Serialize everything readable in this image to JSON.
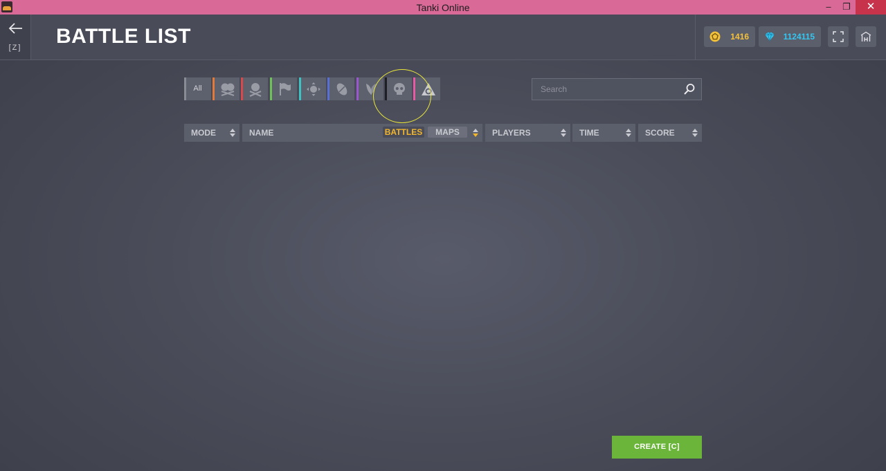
{
  "window": {
    "title": "Tanki Online",
    "minimize": "–",
    "maximize": "❐",
    "close": "✕"
  },
  "header": {
    "back_key": "[Z]",
    "title": "BATTLE LIST",
    "crystals": "1416",
    "rubies": "1124115"
  },
  "filters": {
    "all_label": "All",
    "modes": [
      {
        "icon": "team-deathmatch-icon",
        "color": "#e37a3a"
      },
      {
        "icon": "deathmatch-icon",
        "color": "#d9484a"
      },
      {
        "icon": "capture-the-flag-icon",
        "color": "#6fc25a"
      },
      {
        "icon": "control-points-icon",
        "color": "#3ec3c4"
      },
      {
        "icon": "rugby-icon",
        "color": "#5a6fd6"
      },
      {
        "icon": "assault-icon",
        "color": "#9a57d0"
      },
      {
        "icon": "juggernaut-icon",
        "color": "#1e1f25"
      },
      {
        "icon": "siege-icon",
        "color": "#e85aa3"
      }
    ]
  },
  "search": {
    "placeholder": "Search"
  },
  "columns": {
    "mode": "MODE",
    "name": "NAME",
    "battles": "BATTLES",
    "maps": "MAPS",
    "players": "PLAYERS",
    "time": "TIME",
    "score": "SCORE"
  },
  "create_label": "CREATE [C]"
}
